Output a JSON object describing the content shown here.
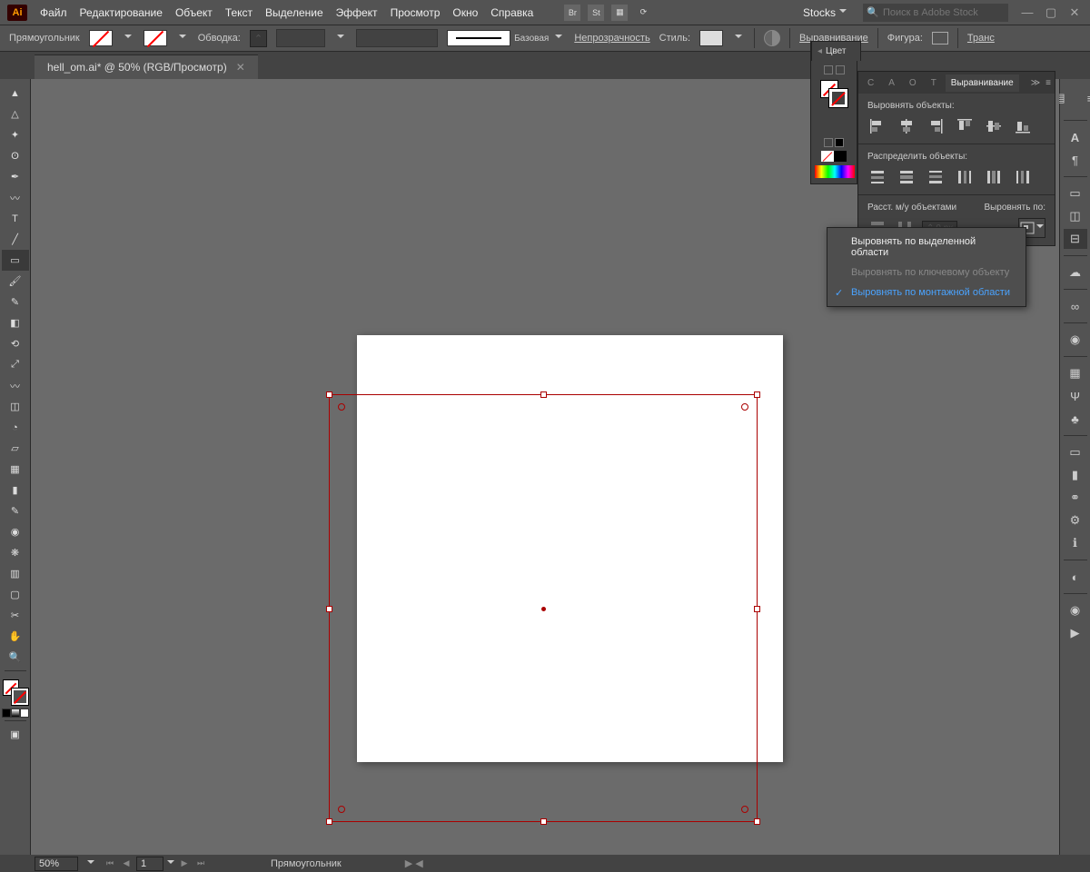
{
  "app": {
    "logo": "Ai"
  },
  "menu": {
    "items": [
      "Файл",
      "Редактирование",
      "Объект",
      "Текст",
      "Выделение",
      "Эффект",
      "Просмотр",
      "Окно",
      "Справка"
    ],
    "stocks": "Stocks",
    "search_placeholder": "Поиск в Adobe Stock"
  },
  "controlbar": {
    "shape_label": "Прямоугольник",
    "stroke_label": "Обводка:",
    "profile_label": "Базовая",
    "opacity_label": "Непрозрачность",
    "style_label": "Стиль:",
    "align_label": "Выравнивание",
    "shape_panel_label": "Фигура:",
    "transform_label": "Транс"
  },
  "document": {
    "tab_title": "hell_om.ai* @ 50% (RGB/Просмотр)"
  },
  "color_panel": {
    "title": "Цвет"
  },
  "align_panel": {
    "tabs": {
      "t1": "С",
      "t2": "А",
      "t3": "О",
      "t4": "Т",
      "active": "Выравнивание"
    },
    "section1": "Выровнять объекты:",
    "section2": "Распределить объекты:",
    "section3": "Расст. м/у объектами",
    "align_to": "Выровнять по:",
    "spacing_value": "0 px"
  },
  "flyout": {
    "item1": "Выровнять по выделенной области",
    "item2": "Выровнять по ключевому объекту",
    "item3": "Выровнять по монтажной области"
  },
  "statusbar": {
    "zoom": "50%",
    "artboard": "1",
    "tool": "Прямоугольник"
  }
}
